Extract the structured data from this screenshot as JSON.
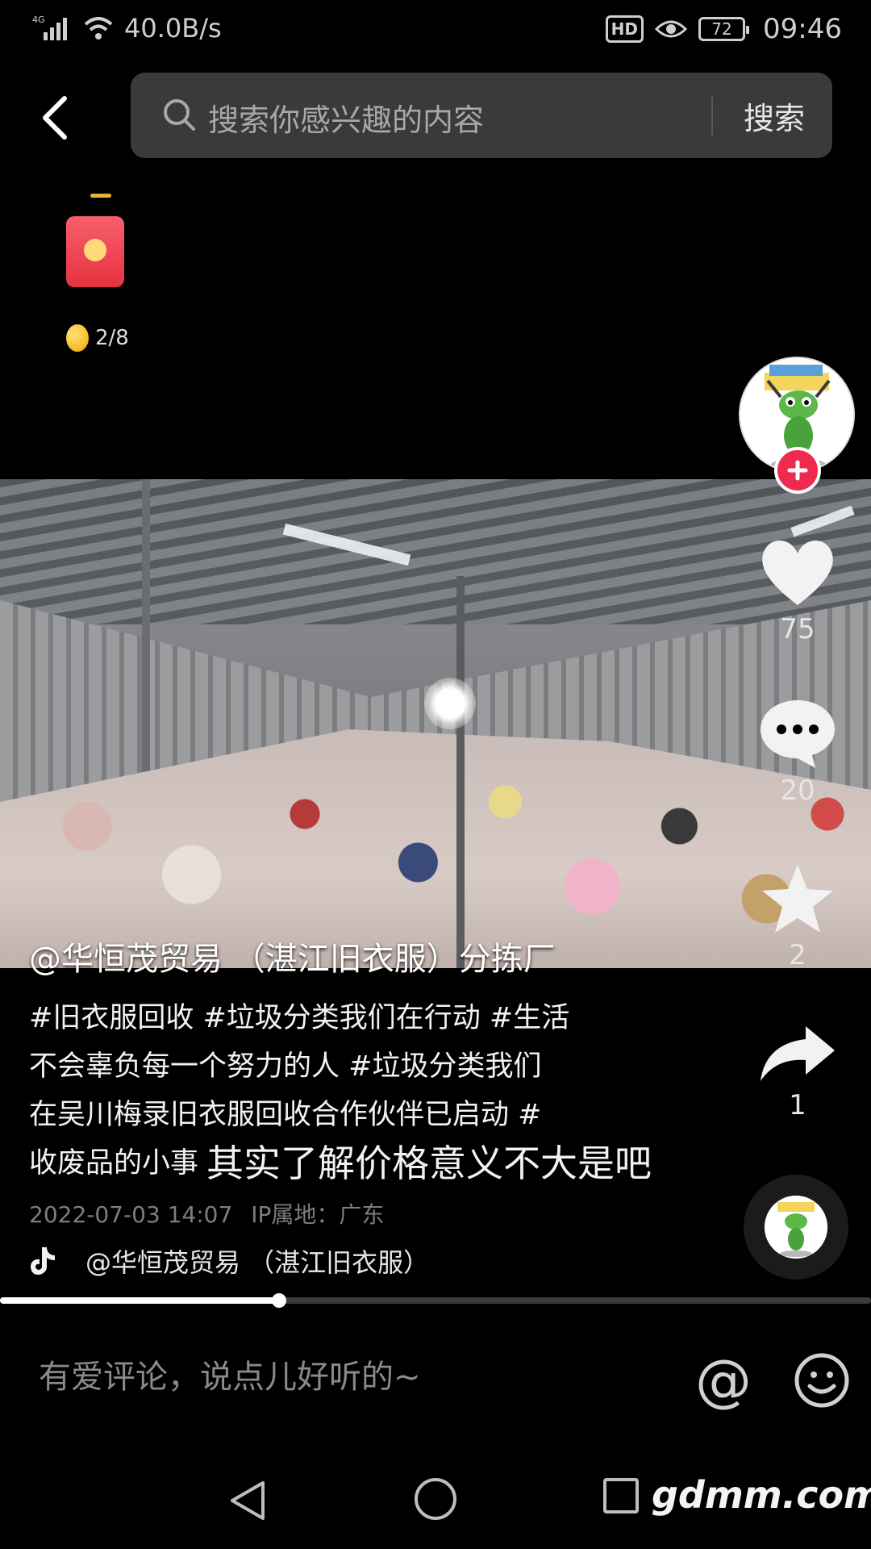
{
  "status_bar": {
    "network": "4G",
    "speed": "40.0B/s",
    "hd": "HD",
    "battery": "72",
    "time": "09:46"
  },
  "top_bar": {
    "search_placeholder": "搜索你感兴趣的内容",
    "search_button": "搜索"
  },
  "red_packet": {
    "progress": "2/8"
  },
  "video": {
    "overlay_text": "@华恒茂贸易 （湛江旧衣服）分拣厂"
  },
  "actions": {
    "likes": "75",
    "comments": "20",
    "favorites": "2",
    "shares": "1"
  },
  "caption": {
    "lines": [
      "#旧衣服回收 #垃圾分类我们在行动 #生活",
      "不会辜负每一个努力的人 #垃圾分类我们",
      "在吴川梅录旧衣服回收合作伙伴已启动 #",
      "收废品的小事"
    ],
    "subtitle": "其实了解价格意义不大是吧"
  },
  "meta": {
    "datetime": "2022-07-03 14:07",
    "ip_location": "IP属地：广东"
  },
  "music": {
    "title": "@华恒茂贸易 （湛江旧衣服）"
  },
  "progress": {
    "fraction": 0.32
  },
  "comment_bar": {
    "placeholder": "有爱评论，说点儿好听的~",
    "at": "@"
  },
  "watermark": "gdmm.com",
  "colors": {
    "accent_red": "#ee2b4f",
    "search_bg": "#3a3a3a"
  }
}
